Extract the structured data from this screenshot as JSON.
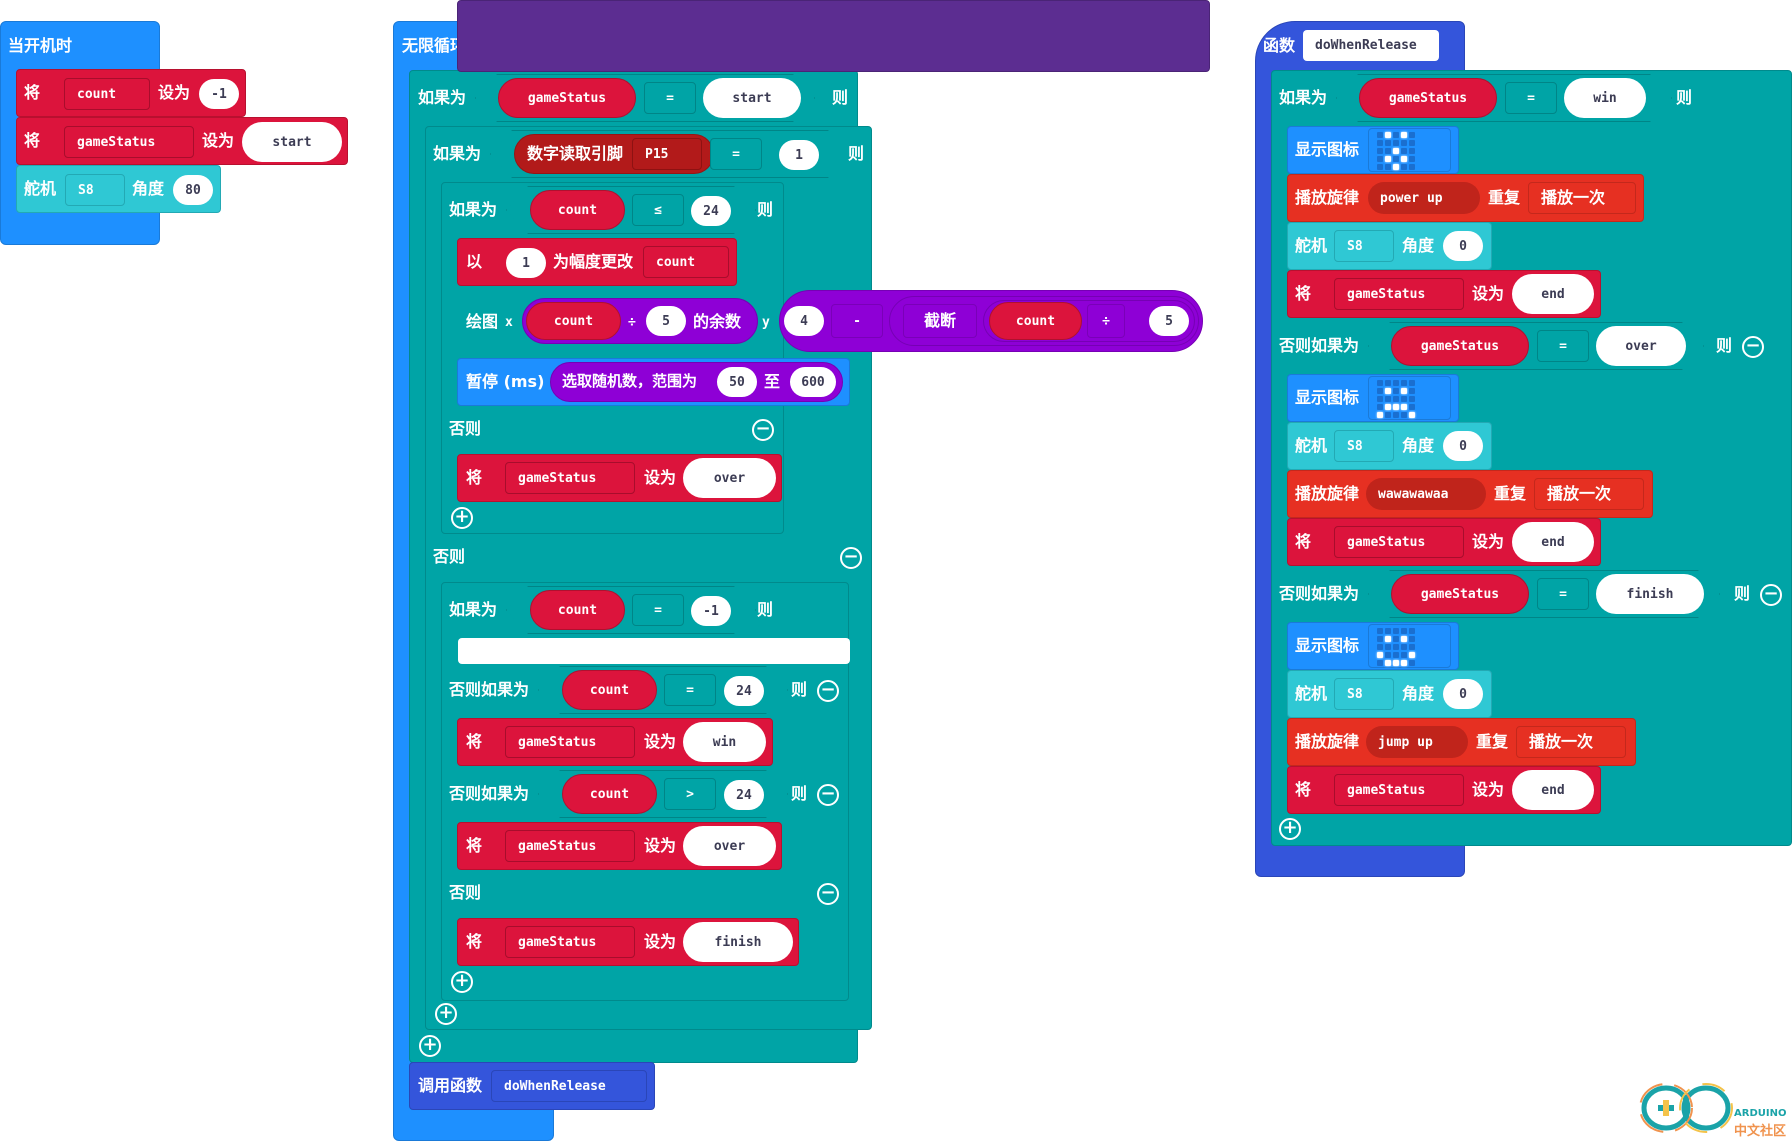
{
  "on_start": {
    "title": "当开机时",
    "set_count": {
      "kw": "将",
      "var": "count",
      "op": "设为",
      "value": "-1"
    },
    "set_status": {
      "kw": "将",
      "var": "gameStatus",
      "op": "设为",
      "value": "start"
    },
    "servo": {
      "kw": "舵机",
      "pin": "S8",
      "angle_kw": "角度",
      "angle": "80"
    }
  },
  "forever": {
    "title": "无限循环",
    "if1": {
      "kw": "如果为",
      "var": "gameStatus",
      "op": "=",
      "value": "start",
      "then": "则"
    },
    "if2": {
      "kw": "如果为",
      "read_kw": "数字读取引脚",
      "pin": "P15",
      "op": "=",
      "value": "1",
      "then": "则"
    },
    "if3": {
      "kw": "如果为",
      "var": "count",
      "op": "≤",
      "value": "24",
      "then": "则"
    },
    "change": {
      "kw": "以",
      "value": "1",
      "mid": "为幅度更改",
      "var": "count"
    },
    "plot": {
      "kw": "绘图",
      "x_kw": "x",
      "x_var": "count",
      "x_op": "÷",
      "x_val": "5",
      "x_suffix": "的余数",
      "y_kw": "y",
      "y_left": "4",
      "y_op": "-",
      "trunc_kw": "截断",
      "y_var": "count",
      "y_div": "÷",
      "y_val": "5"
    },
    "pause": {
      "kw": "暂停 (ms)",
      "rand_kw": "选取随机数，范围为",
      "from": "50",
      "to_kw": "至",
      "to": "600"
    },
    "else3": {
      "kw": "否则"
    },
    "set_over1": {
      "kw": "将",
      "var": "gameStatus",
      "op": "设为",
      "value": "over"
    },
    "else2": {
      "kw": "否则"
    },
    "if4": {
      "kw": "如果为",
      "var": "count",
      "op": "=",
      "value": "-1",
      "then": "则"
    },
    "elif4a": {
      "kw": "否则如果为",
      "var": "count",
      "op": "=",
      "value": "24",
      "then": "则"
    },
    "set_win": {
      "kw": "将",
      "var": "gameStatus",
      "op": "设为",
      "value": "win"
    },
    "elif4b": {
      "kw": "否则如果为",
      "var": "count",
      "op": ">",
      "value": "24",
      "then": "则"
    },
    "set_over2": {
      "kw": "将",
      "var": "gameStatus",
      "op": "设为",
      "value": "over"
    },
    "else4": {
      "kw": "否则"
    },
    "set_finish": {
      "kw": "将",
      "var": "gameStatus",
      "op": "设为",
      "value": "finish"
    },
    "call": {
      "kw": "调用函数",
      "name": "doWhenRelease"
    }
  },
  "function": {
    "kw": "函数",
    "name": "doWhenRelease",
    "if_win": {
      "kw": "如果为",
      "var": "gameStatus",
      "op": "=",
      "value": "win",
      "then": "则"
    },
    "win_icon": {
      "kw": "显示图标",
      "leds": [
        0,
        1,
        0,
        1,
        0,
        0,
        0,
        0,
        0,
        0,
        0,
        0,
        1,
        0,
        0,
        0,
        1,
        0,
        1,
        0,
        0,
        0,
        1,
        0,
        0
      ]
    },
    "win_melody": {
      "kw": "播放旋律",
      "melody": "power up",
      "repeat_kw": "重复",
      "repeat": "播放一次"
    },
    "win_servo": {
      "kw": "舵机",
      "pin": "S8",
      "angle_kw": "角度",
      "angle": "0"
    },
    "win_set": {
      "kw": "将",
      "var": "gameStatus",
      "op": "设为",
      "value": "end"
    },
    "elif_over": {
      "kw": "否则如果为",
      "var": "gameStatus",
      "op": "=",
      "value": "over",
      "then": "则"
    },
    "over_icon": {
      "kw": "显示图标",
      "leds": [
        0,
        0,
        0,
        0,
        0,
        0,
        1,
        0,
        1,
        0,
        0,
        0,
        0,
        0,
        0,
        0,
        1,
        1,
        1,
        0,
        1,
        0,
        0,
        0,
        1
      ]
    },
    "over_servo": {
      "kw": "舵机",
      "pin": "S8",
      "angle_kw": "角度",
      "angle": "0"
    },
    "over_melody": {
      "kw": "播放旋律",
      "melody": "wawawawaa",
      "repeat_kw": "重复",
      "repeat": "播放一次"
    },
    "over_set": {
      "kw": "将",
      "var": "gameStatus",
      "op": "设为",
      "value": "end"
    },
    "elif_finish": {
      "kw": "否则如果为",
      "var": "gameStatus",
      "op": "=",
      "value": "finish",
      "then": "则"
    },
    "finish_icon": {
      "kw": "显示图标",
      "leds": [
        0,
        0,
        0,
        0,
        0,
        0,
        1,
        0,
        1,
        0,
        0,
        0,
        0,
        0,
        0,
        1,
        0,
        0,
        0,
        1,
        0,
        1,
        1,
        1,
        0
      ]
    },
    "finish_servo": {
      "kw": "舵机",
      "pin": "S8",
      "angle_kw": "角度",
      "angle": "0"
    },
    "finish_melody": {
      "kw": "播放旋律",
      "melody": "jump up",
      "repeat_kw": "重复",
      "repeat": "播放一次"
    },
    "finish_set": {
      "kw": "将",
      "var": "gameStatus",
      "op": "设为",
      "value": "end"
    }
  },
  "watermark": {
    "brand": "ARDUINO",
    "sub": "中文社区"
  },
  "colors": {
    "event": "#1e90ff",
    "logic": "#00a4a6",
    "variables": "#dc143c",
    "music": "#e63022",
    "servo": "#2fc8d4",
    "led": "#5c2d91",
    "math": "#8e00d6",
    "functions": "#3455db"
  }
}
